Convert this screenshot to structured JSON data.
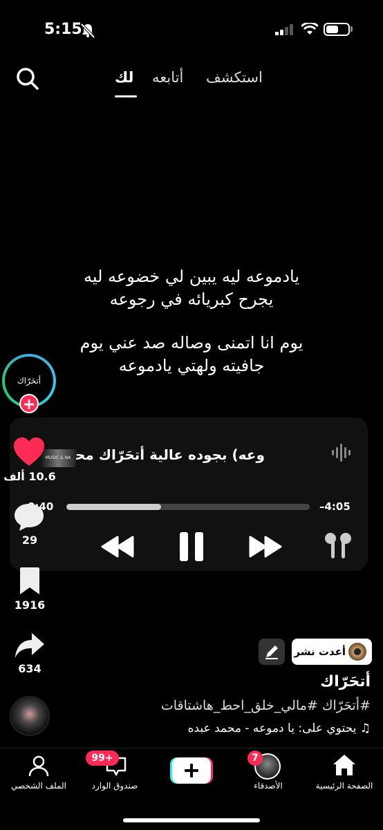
{
  "status_bar": {
    "time": "5:15"
  },
  "top_nav": {
    "tabs": [
      {
        "label": "لك",
        "active": true
      },
      {
        "label": "أتابعه",
        "active": false
      },
      {
        "label": "استكشف",
        "active": false
      }
    ]
  },
  "lyrics": {
    "lines": [
      "يادموعه ليه يبين لي خضوعه ليه",
      "يجرح كبريائه في رجوعه",
      "يوم انا اتمنى وصاله صد عني يوم",
      "جافيته ولهتي يادموعه"
    ]
  },
  "player": {
    "marquee_text": "وعه) بجوده عالية أتحَرّاك    محمد",
    "album_thumb_text": "MUSIC & NA",
    "elapsed": "0:40",
    "remaining": "–4:05",
    "progress_fraction": 0.39
  },
  "creator": {
    "avatar_text": "أتحَرّاك"
  },
  "actions": {
    "likes": "10.6 ألف",
    "comments": "29",
    "saves": "1916",
    "shares": "634"
  },
  "post": {
    "repost_label": "أعدت نشر",
    "username": "أتحَرّاك",
    "hashtags": "#أتحَرّاك #مالي_خلق_احط_هاشتاقات",
    "sound": "يحتوي على: يا دموعه - محمد عبده"
  },
  "bottom_nav": {
    "items": [
      {
        "label": "الصفحة الرئيسية"
      },
      {
        "label": "الأصدقاء",
        "badge": "7"
      },
      {
        "label": ""
      },
      {
        "label": "صندوق الوارد",
        "badge": "99+"
      },
      {
        "label": "الملف الشخصي"
      }
    ]
  },
  "colors": {
    "accent": "#fe2c55",
    "background": "#000000"
  }
}
